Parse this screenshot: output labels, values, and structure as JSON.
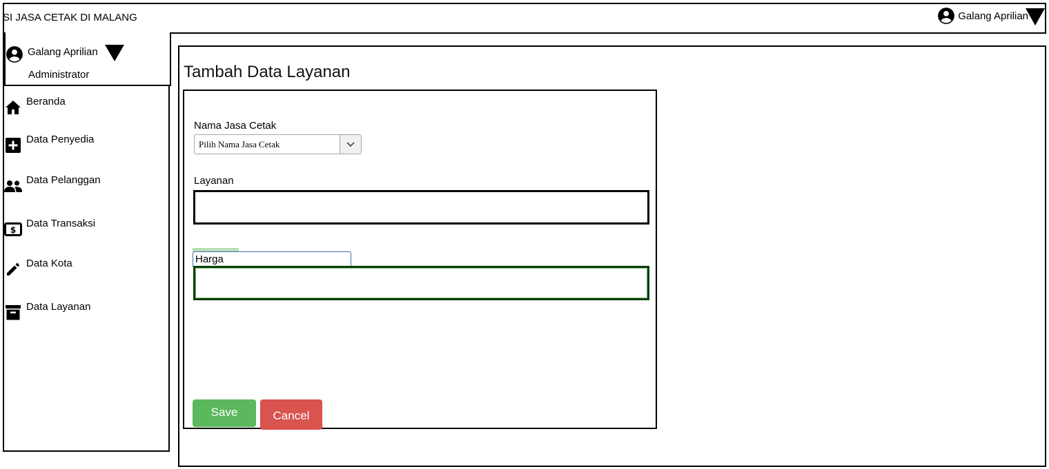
{
  "header": {
    "app_title": "SI JASA CETAK DI MALANG",
    "user_name": "Galang Aprilian"
  },
  "sidebar": {
    "profile": {
      "name": "Galang Aprilian",
      "role": "Administrator"
    },
    "items": [
      {
        "label": "Beranda",
        "icon": "home-icon"
      },
      {
        "label": "Data Penyedia",
        "icon": "plus-box-icon"
      },
      {
        "label": "Data Pelanggan",
        "icon": "people-icon"
      },
      {
        "label": "Data Transaksi",
        "icon": "money-icon"
      },
      {
        "label": "Data Kota",
        "icon": "pencil-icon"
      },
      {
        "label": "Data Layanan",
        "icon": "archive-icon"
      }
    ]
  },
  "main": {
    "page_title": "Tambah Data Layanan",
    "form": {
      "nama_label": "Nama Jasa Cetak",
      "nama_select_value": "Pilih Nama Jasa Cetak",
      "layanan_label": "Layanan",
      "layanan_value": "",
      "harga_label": "Harga",
      "harga_value": "",
      "save_label": "Save",
      "cancel_label": "Cancel"
    }
  },
  "colors": {
    "save": "#5cb85c",
    "cancel": "#d9534f"
  }
}
